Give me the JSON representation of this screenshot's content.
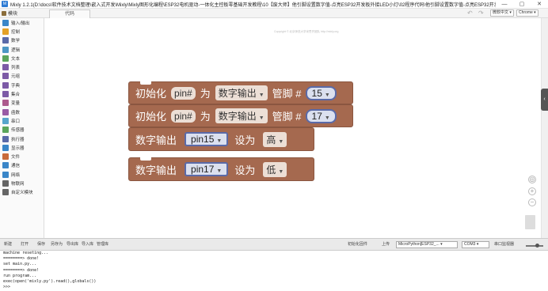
{
  "app": {
    "logo": "M",
    "title": "Mixly 1.2.1(D:\\docs\\软件技术文档整理\\嵌入式开发\\Mixly\\Mixly图形化编程\\ESP32电机驱动-一体化主控板零基础开发教程\\10【废大师】他引脚设置数字值-点亮ESP32开发板外接LED小灯\\02程序代码\\他引脚设置数字值-点亮ESP32开发板外接LED小灯.mix)",
    "window_controls": [
      "—",
      "▢",
      "✕"
    ]
  },
  "toolbar": {
    "modules_label": "模块",
    "code_tab": "代码",
    "undo": "↶",
    "redo": "↷",
    "font_select": "微软中文",
    "browser_select": "Chrome"
  },
  "sidebar": {
    "items": [
      {
        "label": "输入/输出",
        "color": "#3a86c8"
      },
      {
        "label": "控制",
        "color": "#e4a126"
      },
      {
        "label": "数学",
        "color": "#5a6aa8"
      },
      {
        "label": "逻辑",
        "color": "#4c97c4"
      },
      {
        "label": "文本",
        "color": "#5ba55b"
      },
      {
        "label": "列表",
        "color": "#7c5aa6"
      },
      {
        "label": "元组",
        "color": "#7c5aa6"
      },
      {
        "label": "字典",
        "color": "#7c5aa6"
      },
      {
        "label": "集合",
        "color": "#7c5aa6"
      },
      {
        "label": "变量",
        "color": "#ad5a8d"
      },
      {
        "label": "函数",
        "color": "#995ba5"
      },
      {
        "label": "串口",
        "color": "#58a5cc"
      },
      {
        "label": "传感器",
        "color": "#5ca65c"
      },
      {
        "label": "执行器",
        "color": "#5a6aa8"
      },
      {
        "label": "显示器",
        "color": "#3a86c8"
      },
      {
        "label": "文件",
        "color": "#c86a3a"
      },
      {
        "label": "通信",
        "color": "#3a86c8"
      },
      {
        "label": "网络",
        "color": "#3a86c8"
      },
      {
        "label": "物联网",
        "color": "#666666"
      },
      {
        "label": "自定义模块",
        "color": "#666666"
      }
    ]
  },
  "workspace": {
    "copyright": "Copyright © 北京师范大学米思齐团队 http://mixly.org",
    "blocks": [
      {
        "kind": "init",
        "w1": "初始化",
        "field": "pin#",
        "w2": "为",
        "mode": "数字输出",
        "w3": "管脚 #",
        "pin": "15"
      },
      {
        "kind": "init",
        "w1": "初始化",
        "field": "pin#",
        "w2": "为",
        "mode": "数字输出",
        "w3": "管脚 #",
        "pin": "17"
      },
      {
        "kind": "write",
        "w1": "数字输出",
        "var": "pin15",
        "w2": "设为",
        "value": "高"
      },
      {
        "kind": "write",
        "w1": "数字输出",
        "var": "pin17",
        "w2": "设为",
        "value": "低"
      }
    ],
    "zoom_in": "+",
    "zoom_out": "−",
    "recenter": "◎"
  },
  "bottombar": {
    "buttons": [
      "新建",
      "打开",
      "保存",
      "另存为",
      "导出库",
      "导入库",
      "管理库"
    ],
    "init_firmware": "初始化固件",
    "upload": "上传",
    "board": "MicroPython[ESP32_...",
    "port": "COM3",
    "serial_monitor": "串口监视器"
  },
  "console": {
    "lines": [
      "machine reseting...",
      "========> done!",
      "set main.py...",
      "========> done!",
      "run program...",
      "exec(open('mixly.py').read(),globals())",
      ">>>"
    ]
  }
}
